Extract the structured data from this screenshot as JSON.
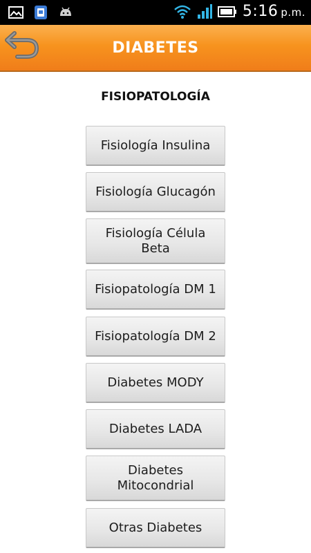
{
  "status_bar": {
    "time": "5:16",
    "ampm": "p.m.",
    "icons_left": [
      "image-icon",
      "phone-app-icon",
      "android-icon"
    ],
    "icons_right": [
      "wifi-icon",
      "signal-icon",
      "battery-icon"
    ]
  },
  "app_bar": {
    "title": "DIABETES",
    "back_icon": "back-arrow-icon",
    "color": "#f7931e"
  },
  "section": {
    "title": "FISIOPATOLOGÍA"
  },
  "buttons": [
    {
      "label": "Fisiología Insulina"
    },
    {
      "label": "Fisiología Glucagón"
    },
    {
      "label": "Fisiología Célula Beta"
    },
    {
      "label": "Fisiopatología DM 1"
    },
    {
      "label": "Fisiopatología DM 2"
    },
    {
      "label": "Diabetes MODY"
    },
    {
      "label": "Diabetes LADA"
    },
    {
      "label": "Diabetes Mitocondrial"
    },
    {
      "label": "Otras Diabetes"
    }
  ]
}
